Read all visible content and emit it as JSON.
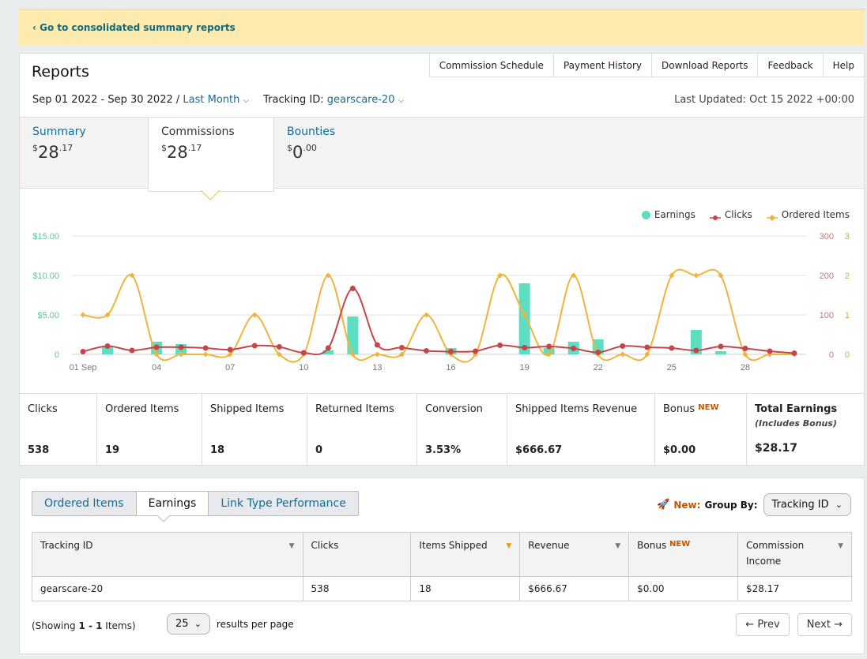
{
  "banner": {
    "link": "‹ Go to consolidated summary reports"
  },
  "header": {
    "title": "Reports",
    "nav": [
      "Commission Schedule",
      "Payment History",
      "Download Reports",
      "Feedback",
      "Help"
    ],
    "date_range": "Sep 01 2022 - Sep 30 2022 /",
    "period": "Last Month",
    "tracking_label": "Tracking ID:",
    "tracking_id": "gearscare-20",
    "last_updated": "Last Updated: Oct 15 2022 +00:00"
  },
  "summary_tabs": [
    {
      "label": "Summary",
      "currency": "$",
      "whole": "28",
      "cents": ".17"
    },
    {
      "label": "Commissions",
      "currency": "$",
      "whole": "28",
      "cents": ".17"
    },
    {
      "label": "Bounties",
      "currency": "$",
      "whole": "0",
      "cents": ".00"
    }
  ],
  "chart_data": {
    "type": "bar+line",
    "legend": [
      "Earnings",
      "Clicks",
      "Ordered Items"
    ],
    "legend_position": "top-right",
    "colors": {
      "earnings": "#5ddec0",
      "clicks": "#c5464a",
      "ordered": "#f0b43a"
    },
    "x_labels": [
      "01 Sep",
      "04",
      "07",
      "10",
      "13",
      "16",
      "19",
      "22",
      "25",
      "28"
    ],
    "y_left_ticks": [
      "$15.00",
      "$10.00",
      "$5.00",
      "0"
    ],
    "y_right_clicks_ticks": [
      "300",
      "200",
      "100",
      "0"
    ],
    "y_right_items_ticks": [
      "3",
      "2",
      "1",
      "0"
    ],
    "days": [
      1,
      2,
      3,
      4,
      5,
      6,
      7,
      8,
      9,
      10,
      11,
      12,
      13,
      14,
      15,
      16,
      17,
      18,
      19,
      20,
      21,
      22,
      23,
      24,
      25,
      26,
      27,
      28,
      29,
      30
    ],
    "earnings": [
      0,
      1.0,
      0,
      1.6,
      1.3,
      0,
      0,
      0,
      0,
      0,
      0.5,
      4.8,
      0,
      0,
      0,
      0.8,
      0,
      0,
      9.0,
      0.8,
      1.6,
      1.9,
      0,
      0,
      0,
      3.1,
      0.4,
      0,
      0,
      0
    ],
    "clicks": [
      7,
      21,
      10,
      18,
      18,
      16,
      12,
      22,
      19,
      4,
      16,
      167,
      24,
      17,
      9,
      7,
      8,
      23,
      17,
      20,
      15,
      5,
      21,
      18,
      16,
      10,
      20,
      15,
      8,
      3
    ],
    "ordered_items": [
      1,
      1,
      2,
      0,
      0,
      0,
      0,
      1,
      0,
      0,
      2,
      0,
      0,
      0,
      1,
      0,
      0,
      2,
      1,
      0,
      2,
      0,
      0,
      0,
      2,
      2,
      2,
      0,
      0,
      0
    ],
    "ylim_earnings": [
      0,
      15
    ],
    "ylim_clicks": [
      0,
      300
    ],
    "ylim_items": [
      0,
      3
    ]
  },
  "metrics": [
    {
      "label": "Clicks",
      "value": "538"
    },
    {
      "label": "Ordered Items",
      "value": "19"
    },
    {
      "label": "Shipped Items",
      "value": "18"
    },
    {
      "label": "Returned Items",
      "value": "0"
    },
    {
      "label": "Conversion",
      "value": "3.53%"
    },
    {
      "label": "Shipped Items Revenue",
      "value": "$666.67"
    },
    {
      "label": "Bonus",
      "badge": "NEW",
      "value": "$0.00"
    },
    {
      "label": "Total Earnings",
      "sub": "(Includes Bonus)",
      "value": "$28.17"
    }
  ],
  "table_tabs": [
    "Ordered Items",
    "Earnings",
    "Link Type Performance"
  ],
  "group_by": {
    "new": "New:",
    "label": "Group By:",
    "value": "Tracking ID"
  },
  "table": {
    "headers": [
      "Tracking ID",
      "Clicks",
      "Items Shipped",
      "Revenue",
      "Bonus",
      "Commission Income"
    ],
    "header_badge": "NEW",
    "row": [
      "gearscare-20",
      "538",
      "18",
      "$666.67",
      "$0.00",
      "$28.17"
    ]
  },
  "footer": {
    "showing_prefix": "(Showing ",
    "showing_range": "1 - 1",
    "showing_suffix": " Items)",
    "per_page": "25",
    "per_page_label": "results per page",
    "prev": "←  Prev",
    "next": "Next  →"
  }
}
